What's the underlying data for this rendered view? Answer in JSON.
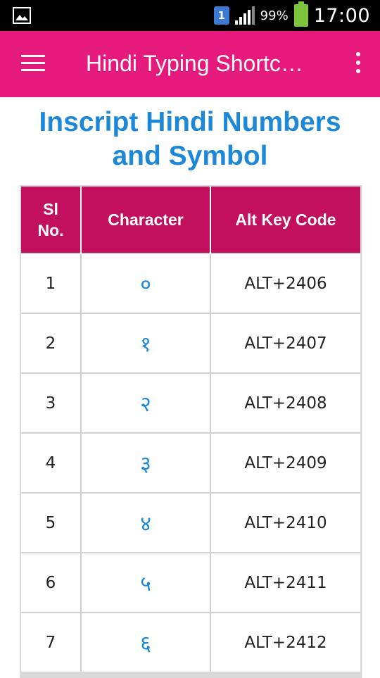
{
  "status_bar": {
    "sim_label": "1",
    "battery_pct": "99%",
    "time": "17:00",
    "icons": [
      "image-icon",
      "sim-icon",
      "signal-icon",
      "battery-icon"
    ]
  },
  "app_bar": {
    "title": "Hindi Typing Shortc…",
    "color": "#e6197d"
  },
  "page": {
    "title_line1": "Inscript Hindi Numbers",
    "title_line2": "and Symbol",
    "title_color": "#1e88d8"
  },
  "table": {
    "header_color": "#c2105f",
    "headers": {
      "sl_line1": "Sl",
      "sl_line2": "No.",
      "character": "Character",
      "code": "Alt Key Code"
    },
    "rows": [
      {
        "sl": "1",
        "char": "०",
        "code": "ALT+2406"
      },
      {
        "sl": "2",
        "char": "१",
        "code": "ALT+2407"
      },
      {
        "sl": "3",
        "char": "२",
        "code": "ALT+2408"
      },
      {
        "sl": "4",
        "char": "३",
        "code": "ALT+2409"
      },
      {
        "sl": "5",
        "char": "४",
        "code": "ALT+2410"
      },
      {
        "sl": "6",
        "char": "५",
        "code": "ALT+2411"
      },
      {
        "sl": "7",
        "char": "६",
        "code": "ALT+2412"
      }
    ]
  }
}
